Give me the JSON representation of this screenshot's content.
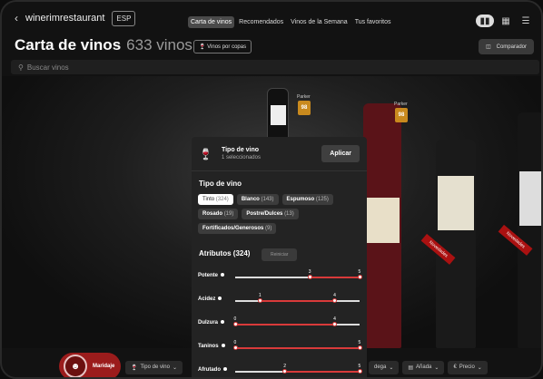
{
  "topbar": {
    "back_icon": "chevron-left-icon",
    "restaurant": "winerimrestaurant",
    "lang": "ESP",
    "tabs": [
      {
        "label": "Carta de vinos",
        "active": true
      },
      {
        "label": "Recomendados",
        "active": false
      },
      {
        "label": "Vinos de la Semana",
        "active": false
      },
      {
        "label": "Tus favoritos",
        "active": false
      }
    ]
  },
  "header": {
    "title": "Carta de vinos",
    "count": "633 vinos",
    "copas_label": "Vinos por copas",
    "comparador_label": "Comparador"
  },
  "search": {
    "placeholder": "Buscar vinos"
  },
  "shelf": {
    "badges": [
      {
        "label": "Parker",
        "value": "98"
      },
      {
        "label": "Parker",
        "value": "98"
      }
    ],
    "ribbons": [
      "Novedades",
      "Novedades"
    ]
  },
  "filter_panel": {
    "title": "Tipo de vino",
    "subtitle": "1 seleccionados",
    "apply_label": "Aplicar",
    "section_type": "Tipo de vino",
    "chips": [
      {
        "label": "Tinto",
        "count": "(324)",
        "selected": true
      },
      {
        "label": "Blanco",
        "count": "(143)",
        "selected": false
      },
      {
        "label": "Espumoso",
        "count": "(125)",
        "selected": false
      },
      {
        "label": "Rosado",
        "count": "(19)",
        "selected": false
      },
      {
        "label": "Postre/Dulces",
        "count": "(13)",
        "selected": false
      },
      {
        "label": "Fortificados/Generosos",
        "count": "(9)",
        "selected": false
      }
    ],
    "attributes_title": "Atributos (324)",
    "reset_label": "Reiniciar",
    "attributes": [
      {
        "label": "Potente",
        "min": 3,
        "max": 5
      },
      {
        "label": "Acidez",
        "min": 1,
        "max": 4
      },
      {
        "label": "Dulzura",
        "min": 0,
        "max": 4
      },
      {
        "label": "Taninos",
        "min": 0,
        "max": 5
      },
      {
        "label": "Afrutado",
        "min": 2,
        "max": 5
      }
    ]
  },
  "bottombar": {
    "maridaje": "Maridaje",
    "tipo": "Tipo de vino",
    "bodega_partial": "dega",
    "anada": "Añada",
    "precio": "Precio"
  },
  "colors": {
    "accent": "#d93a3a",
    "badge": "#c98a1e",
    "maridaje": "#9b1c1c"
  }
}
